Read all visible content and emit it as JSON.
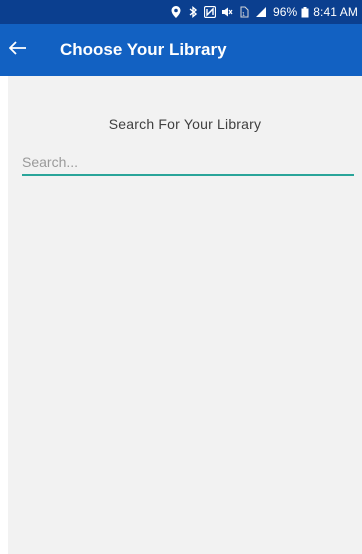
{
  "status_bar": {
    "battery_percent": "96%",
    "time": "8:41 AM",
    "icons": [
      "location-icon",
      "bluetooth-icon",
      "nfc-icon",
      "mute-icon",
      "sim-icon",
      "signal-icon",
      "battery-icon"
    ]
  },
  "app_bar": {
    "title": "Choose Your Library",
    "back_icon": "arrow-left-icon"
  },
  "search": {
    "label": "Search For Your Library",
    "placeholder": "Search...",
    "value": ""
  },
  "colors": {
    "status_bar": "#0b3f8f",
    "app_bar": "#1261c2",
    "accent_underline": "#2aa59a",
    "content_bg": "#f2f2f2"
  }
}
